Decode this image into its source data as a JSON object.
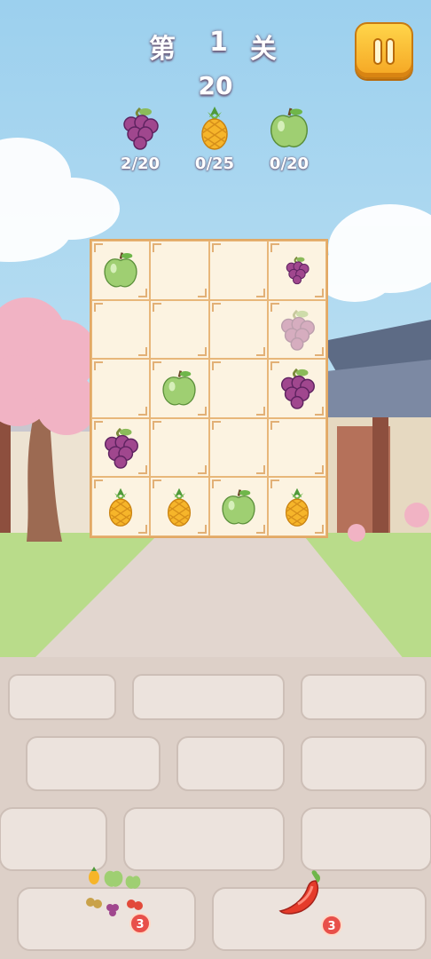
{
  "header": {
    "level_prefix": "第",
    "level_number": "1",
    "level_suffix": "关",
    "moves_left": "20"
  },
  "goals": [
    {
      "fruit": "grape",
      "count": "2/20"
    },
    {
      "fruit": "pineapple",
      "count": "0/25"
    },
    {
      "fruit": "apple",
      "count": "0/20"
    }
  ],
  "board": {
    "rows": 5,
    "cols": 4,
    "cells": [
      [
        "apple",
        "",
        "",
        "grape-small"
      ],
      [
        "",
        "",
        "",
        "grape-faded"
      ],
      [
        "",
        "apple",
        "",
        "grape"
      ],
      [
        "grape",
        "",
        "",
        ""
      ],
      [
        "pineapple",
        "pineapple",
        "apple",
        "pineapple"
      ]
    ]
  },
  "boosters": [
    {
      "name": "shuffle-fruits",
      "count": "3"
    },
    {
      "name": "chili-pepper",
      "count": "3"
    }
  ],
  "colors": {
    "accent": "#f5a623",
    "grape": "#a0478e",
    "pineapple": "#f6b52a",
    "apple": "#9fcf72",
    "badge": "#e8504a"
  }
}
